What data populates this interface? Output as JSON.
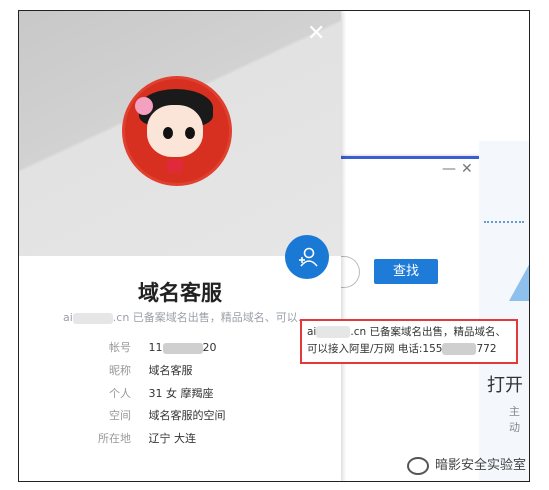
{
  "card": {
    "name": "域名客服",
    "signature_start": "ai",
    "signature_rest": ".cn 已备案域名出售，精品域名、可以...",
    "fields": [
      {
        "label": "帐号",
        "value_start": "11",
        "value_end": "20"
      },
      {
        "label": "昵称",
        "value": "域名客服"
      },
      {
        "label": "个人",
        "value": "31 女 摩羯座"
      },
      {
        "label": "空间",
        "value": "域名客服的空间"
      },
      {
        "label": "所在地",
        "value": "辽宁 大连"
      }
    ]
  },
  "tooltip": {
    "line1_start": "ai",
    "line1_rest": ".cn 已备案域名出售，精品域名、",
    "line2_start": "可以接入阿里/万网 电话:155",
    "line2_end": "772"
  },
  "search_window": {
    "search_button": "查找",
    "min_symbol": "—",
    "close_symbol": "✕"
  },
  "right_page": {
    "open_text": "打开",
    "sub_text": "主动"
  },
  "watermark": "暗影安全实验室",
  "icons": {
    "card_close": "close-icon",
    "add_friend": "add-friend-icon",
    "wechat": "wechat-icon"
  },
  "colors": {
    "accent_blue": "#1e7bd8",
    "highlight_red": "#e23a3a"
  }
}
